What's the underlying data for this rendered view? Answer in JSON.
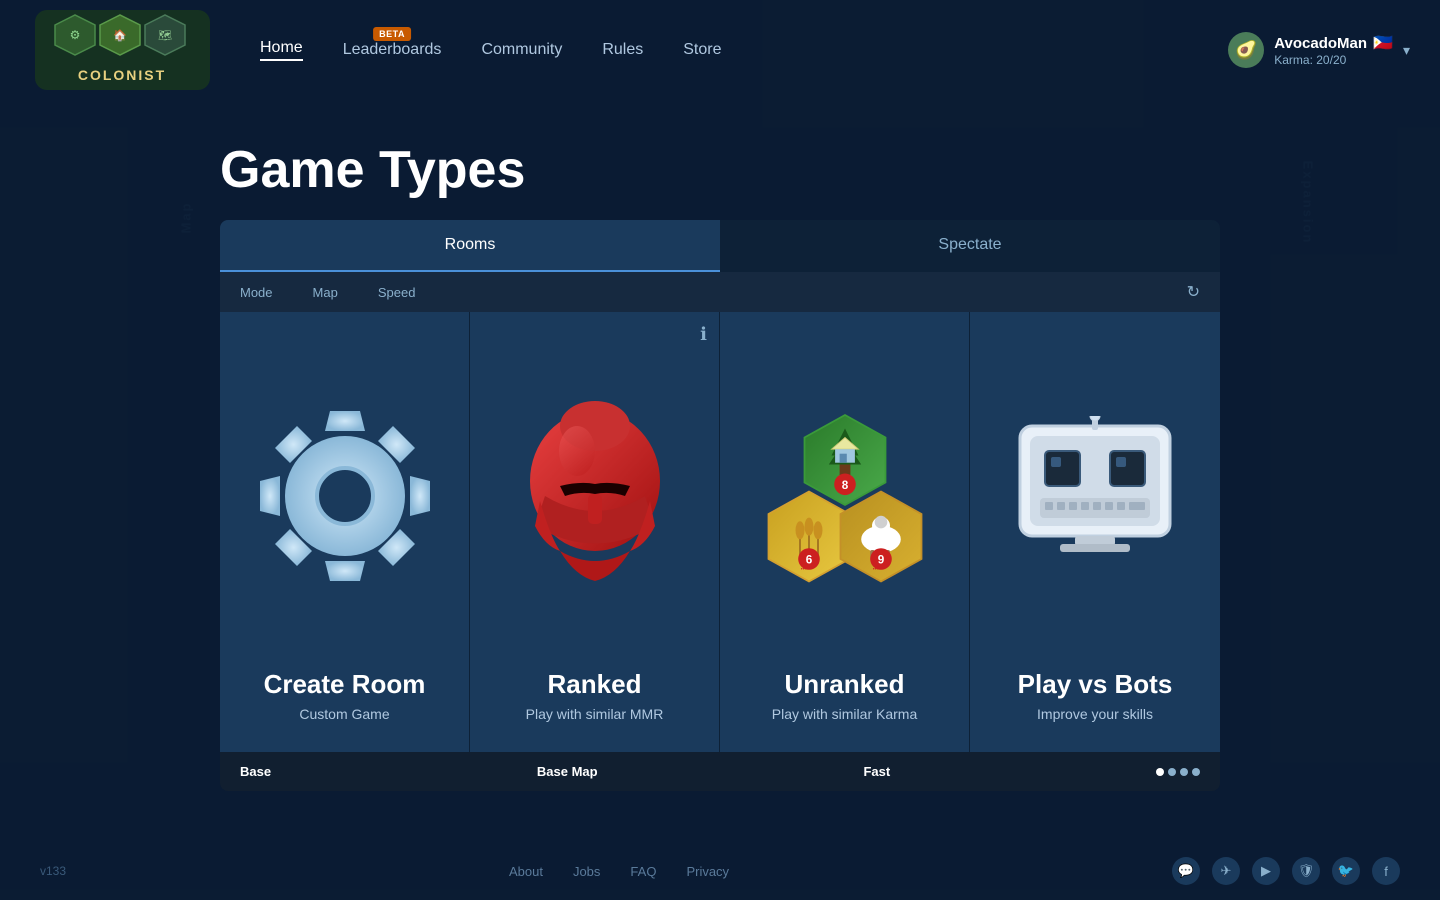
{
  "app": {
    "version": "v133"
  },
  "navbar": {
    "logo_text": "COLONIST",
    "links": [
      {
        "label": "Home",
        "active": true,
        "beta": false,
        "id": "home"
      },
      {
        "label": "Leaderboards",
        "active": false,
        "beta": true,
        "id": "leaderboards"
      },
      {
        "label": "Community",
        "active": false,
        "beta": false,
        "id": "community"
      },
      {
        "label": "Rules",
        "active": false,
        "beta": false,
        "id": "rules"
      },
      {
        "label": "Store",
        "active": false,
        "beta": false,
        "id": "store"
      }
    ],
    "beta_label": "BETA",
    "user": {
      "name": "AvocadoMan",
      "avatar_emoji": "🥑",
      "karma": "Karma: 20/20",
      "flag": "🇵🇭"
    }
  },
  "page": {
    "title": "Game Types"
  },
  "tabs": [
    {
      "label": "Rooms",
      "active": true
    },
    {
      "label": "Spectate",
      "active": false
    }
  ],
  "filters": {
    "mode_label": "Mode",
    "map_label": "Map",
    "speed_label": "Speed"
  },
  "cards": [
    {
      "id": "create-room",
      "title": "Create Room",
      "subtitle": "Custom Game",
      "has_info": false,
      "icon_type": "gear"
    },
    {
      "id": "ranked",
      "title": "Ranked",
      "subtitle": "Play with similar MMR",
      "has_info": true,
      "icon_type": "helmet"
    },
    {
      "id": "unranked",
      "title": "Unranked",
      "subtitle": "Play with similar Karma",
      "has_info": false,
      "icon_type": "hexes"
    },
    {
      "id": "play-vs-bots",
      "title": "Play vs Bots",
      "subtitle": "Improve your skills",
      "has_info": false,
      "icon_type": "bot"
    }
  ],
  "bottom_bar": {
    "mode_label": "Base",
    "map_label": "Base Map",
    "speed_label": "Fast",
    "dots": [
      1,
      2,
      3,
      4
    ]
  },
  "footer": {
    "version": "v133",
    "links": [
      "About",
      "Jobs",
      "FAQ",
      "Privacy"
    ],
    "icons": [
      "discord",
      "telegram",
      "youtube",
      "shield",
      "twitter",
      "facebook"
    ]
  },
  "background": {
    "map_label": "Map",
    "expansion_label": "Expansion"
  }
}
